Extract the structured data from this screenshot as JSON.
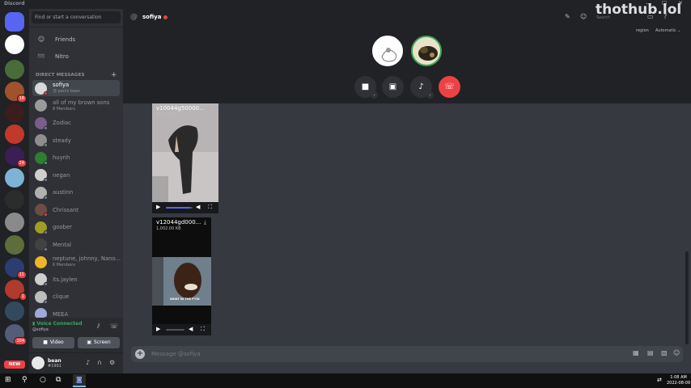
{
  "window": {
    "title": "Discord",
    "controls": [
      "—",
      "☐",
      "✕"
    ]
  },
  "watermark": "thothub.lol",
  "rail": {
    "servers": [
      {
        "color": "#5865f2",
        "home": true
      },
      {
        "color": "#ffffff",
        "badge": ""
      },
      {
        "color": "#4a6b3a",
        "badge": ""
      },
      {
        "color": "#a0522d",
        "badge": "18"
      },
      {
        "color": "#3a1d1d",
        "badge": ""
      },
      {
        "color": "#c0392b",
        "badge": ""
      },
      {
        "color": "#3b1e54",
        "badge": "24"
      },
      {
        "color": "#7fb3d5",
        "badge": ""
      },
      {
        "color": "#2c2c2c",
        "badge": ""
      },
      {
        "color": "#8a8a8a",
        "badge": ""
      },
      {
        "color": "#5d6d3b",
        "badge": ""
      },
      {
        "color": "#2c3e70",
        "badge": "11"
      },
      {
        "color": "#b03a2e",
        "badge": "1"
      },
      {
        "color": "#34495e",
        "badge": ""
      },
      {
        "color": "#555c7a",
        "badge": "204"
      }
    ],
    "new_label": "NEW"
  },
  "sidebar": {
    "search_placeholder": "Find or start a conversation",
    "nav": [
      {
        "label": "Friends",
        "icon": "friends-icon",
        "glyph": "☺"
      },
      {
        "label": "Nitro",
        "icon": "nitro-icon",
        "glyph": "⚙"
      }
    ],
    "dm_header": "DIRECT MESSAGES",
    "dms": [
      {
        "name": "sofiya",
        "sub": "😍 penis bean",
        "selected": true,
        "color": "#d8d8d8",
        "status": "#ed4245"
      },
      {
        "name": "all of my brown sons",
        "sub": "8 Members",
        "color": "#9a9a9a",
        "status": ""
      },
      {
        "name": "Zodiac",
        "sub": "",
        "color": "#7a5d8a",
        "status": "#747f8d"
      },
      {
        "name": "steady",
        "sub": "",
        "color": "#8e8e8e",
        "status": "#747f8d"
      },
      {
        "name": "huynh",
        "sub": "",
        "color": "#2e7d32",
        "status": "#3ba55d"
      },
      {
        "name": "negan",
        "sub": "",
        "color": "#cfcfcf",
        "status": "#747f8d"
      },
      {
        "name": "austinn",
        "sub": "",
        "color": "#b0b0b0",
        "status": "#747f8d"
      },
      {
        "name": "Chrissant",
        "sub": "",
        "color": "#6d4c41",
        "status": "#ed4245"
      },
      {
        "name": "goober",
        "sub": "",
        "color": "#9e9d24",
        "status": "#747f8d"
      },
      {
        "name": "Mental",
        "sub": "",
        "color": "#424242",
        "status": "#747f8d"
      },
      {
        "name": "neptune, johnny, Nano...",
        "sub": "6 Members",
        "color": "#f0b429",
        "status": ""
      },
      {
        "name": "its.jaylen",
        "sub": "",
        "color": "#cfcfcf",
        "status": "#747f8d"
      },
      {
        "name": "clique",
        "sub": "",
        "color": "#bdbdbd",
        "status": "#747f8d"
      },
      {
        "name": "MEEA",
        "sub": "",
        "color": "#9fa8da",
        "status": "#747f8d"
      }
    ]
  },
  "voice": {
    "status": "Voice Connected",
    "channel": "@sofiya",
    "video_label": "Video",
    "screen_label": "Screen"
  },
  "user": {
    "name": "bean",
    "tag": "#1991"
  },
  "header": {
    "channel_name": "sofiya",
    "search_placeholder": "Search",
    "region_label": "region",
    "region_value": "Automatic ⌄"
  },
  "attachments": [
    {
      "filename": "v10044g50000...",
      "size": "859.29 KB",
      "progress": 0.9
    },
    {
      "filename": "v12044gd000...",
      "size": "1,002.00 KB",
      "progress": 0.0
    }
  ],
  "video_overlay_text": "WHAT IN THE F*CK",
  "composer": {
    "placeholder": "Message @sofiya"
  },
  "taskbar": {
    "time": "1:08 AM",
    "date": "2022-08-09"
  }
}
